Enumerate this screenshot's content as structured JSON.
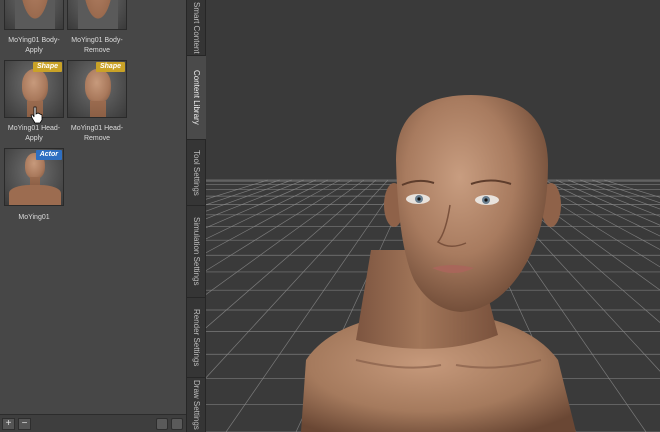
{
  "library": {
    "items": [
      {
        "label_line1": "MoYing01 Body-",
        "label_line2": "Apply",
        "badge": ""
      },
      {
        "label_line1": "MoYing01 Body-",
        "label_line2": "Remove",
        "badge": ""
      },
      {
        "label_line1": "MoYing01 Head-",
        "label_line2": "Apply",
        "badge": "Shape"
      },
      {
        "label_line1": "MoYing01 Head-",
        "label_line2": "Remove",
        "badge": "Shape"
      },
      {
        "label_line1": "MoYing01",
        "label_line2": "",
        "badge": "Actor"
      }
    ],
    "add_label": "+",
    "remove_label": "−"
  },
  "tabs": [
    {
      "label": "Smart Content"
    },
    {
      "label": "Content Library"
    },
    {
      "label": "Tool Settings"
    },
    {
      "label": "Simulation Settings"
    },
    {
      "label": "Render Settings"
    },
    {
      "label": "Draw Settings"
    }
  ],
  "colors": {
    "shape_badge": "#c9a227",
    "actor_badge": "#2f6fc1",
    "skin": "#b08468",
    "grid_line": "#8a8a8a"
  }
}
